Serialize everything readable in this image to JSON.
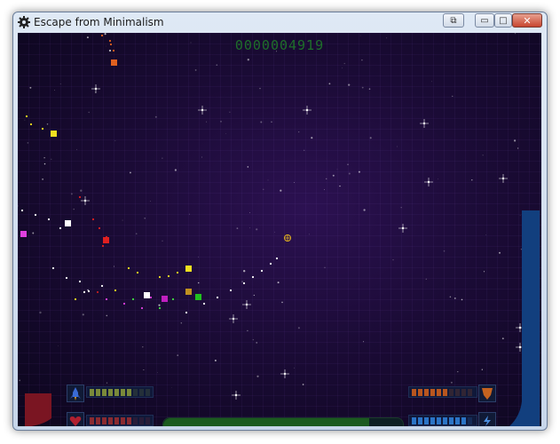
{
  "window": {
    "title": "Escape from Minimalism",
    "buttons": {
      "extra": "⧉",
      "minimize": "▭",
      "maximize": "□",
      "close": "✕"
    }
  },
  "game": {
    "score": "0000004919",
    "hud": {
      "engine": {
        "icon": "rocket-icon",
        "level": 0.7,
        "segments": 10,
        "color": "#7a8a3a"
      },
      "health": {
        "icon": "heart-icon",
        "level": 0.7,
        "segments": 10,
        "color": "#8a2a30"
      },
      "weapon": {
        "icon": "shield-icon",
        "level": 0.6,
        "segments": 10,
        "color": "#b8561f"
      },
      "energy": {
        "icon": "lightning-icon",
        "level": 0.9,
        "segments": 10,
        "color": "#2b74c6"
      },
      "center_progress": 0.86,
      "left_gauge_color": "#7a1522",
      "right_gauge_color": "#123f7e"
    },
    "colors": {
      "score": "#1e6e2a",
      "background": "#1b0b36"
    }
  }
}
